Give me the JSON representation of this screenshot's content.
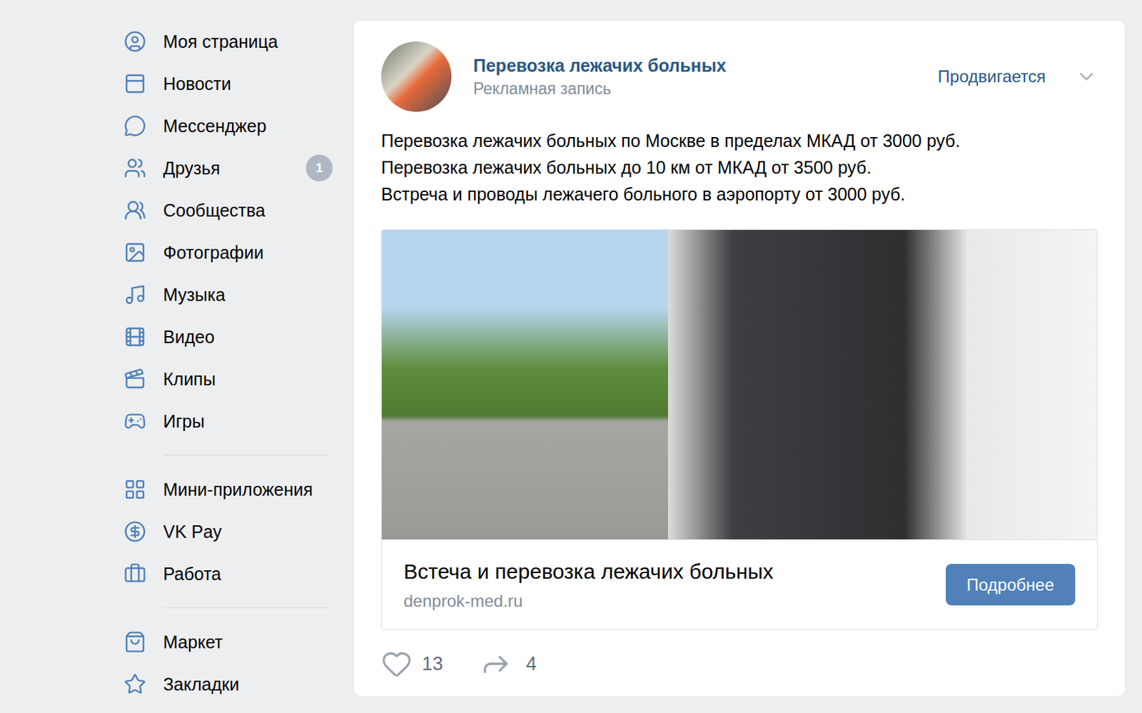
{
  "sidebar": {
    "groups": [
      [
        {
          "label": "Моя страница"
        },
        {
          "label": "Новости"
        },
        {
          "label": "Мессенджер"
        },
        {
          "label": "Друзья",
          "badge": "1"
        },
        {
          "label": "Сообщества"
        },
        {
          "label": "Фотографии"
        },
        {
          "label": "Музыка"
        },
        {
          "label": "Видео"
        },
        {
          "label": "Клипы"
        },
        {
          "label": "Игры"
        }
      ],
      [
        {
          "label": "Мини-приложения"
        },
        {
          "label": "VK Pay"
        },
        {
          "label": "Работа"
        }
      ],
      [
        {
          "label": "Маркет"
        },
        {
          "label": "Закладки"
        }
      ]
    ]
  },
  "post": {
    "author": "Перевозка лежачих больных",
    "subtitle": "Рекламная запись",
    "status": "Продвигается",
    "lines": [
      "Перевозка лежачих больных по Москве в пределах МКАД от 3000 руб.",
      "Перевозка лежачих больных до 10 км от МКАД от 3500 руб.",
      "Встреча и проводы лежачего больного в аэропорту от 3000 руб."
    ],
    "link": {
      "title": "Встеча и перевозка лежачих больных",
      "domain": "denprok-med.ru",
      "button": "Подробнее"
    },
    "likes": "13",
    "shares": "4"
  }
}
